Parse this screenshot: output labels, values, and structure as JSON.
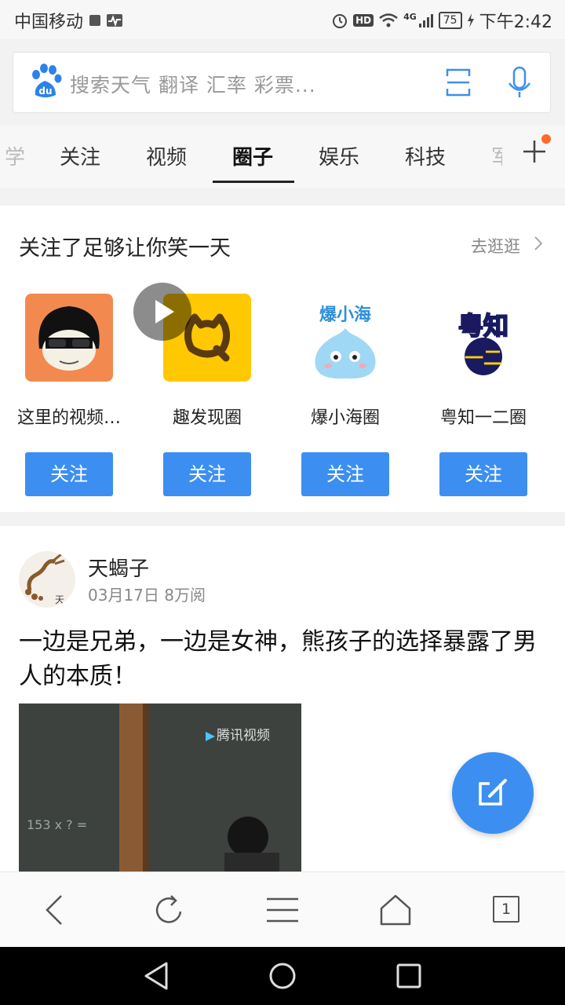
{
  "status_bar": {
    "carrier": "中国移动",
    "network": "4G",
    "battery": "75",
    "time": "下午2:42"
  },
  "search": {
    "placeholder": "搜索天气 翻译 汇率 彩票..."
  },
  "tabs": [
    {
      "label": "学"
    },
    {
      "label": "关注"
    },
    {
      "label": "视频"
    },
    {
      "label": "圈子"
    },
    {
      "label": "娱乐"
    },
    {
      "label": "科技"
    },
    {
      "label": "军"
    }
  ],
  "active_tab": "圈子",
  "recommend_card": {
    "title": "关注了足够让你笑一天",
    "more_label": "去逛逛",
    "circles": [
      {
        "name": "这里的视频…",
        "follow_label": "关注"
      },
      {
        "name": "趣发现圈",
        "follow_label": "关注"
      },
      {
        "name": "爆小海圈",
        "follow_label": "关注"
      },
      {
        "name": "粤知一二圈",
        "follow_label": "关注"
      }
    ]
  },
  "post": {
    "author": "天蝎子",
    "date": "03月17日",
    "views": "8万阅",
    "title": "一边是兄弟，一边是女神，熊孩子的选择暴露了男人的本质！",
    "video_watermark": "腾讯视频",
    "avatar_mark": "天"
  },
  "bottom_bar": {
    "tab_count": "1"
  },
  "logo_text": {
    "baidu": "du",
    "bao_xiao_hai": "爆小海",
    "yue_zhi_top": "粤知",
    "yue_zhi_bottom": "一二"
  },
  "colors": {
    "accent": "#3c8ff0",
    "notification": "#ff6a2b"
  }
}
